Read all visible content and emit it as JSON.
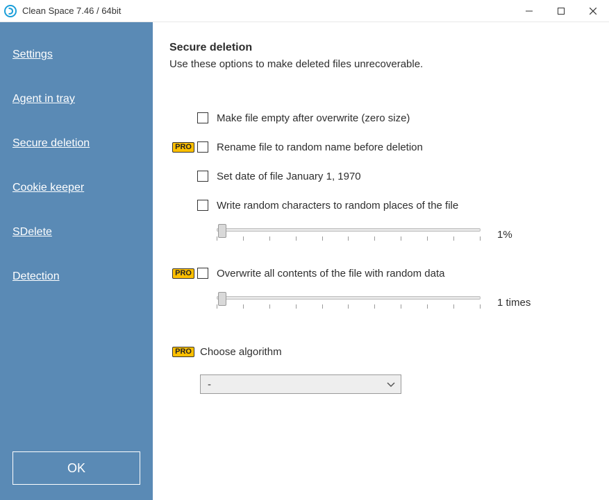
{
  "window": {
    "title": "Clean Space 7.46 / 64bit"
  },
  "sidebar": {
    "items": [
      {
        "label": "Settings"
      },
      {
        "label": "Agent in tray"
      },
      {
        "label": "Secure deletion"
      },
      {
        "label": "Cookie keeper"
      },
      {
        "label": "SDelete"
      },
      {
        "label": "Detection"
      }
    ],
    "ok_label": "OK"
  },
  "main": {
    "heading": "Secure deletion",
    "subtitle": "Use these options to make deleted files unrecoverable.",
    "pro_badge": "PRO",
    "options": {
      "make_empty": "Make file empty after overwrite (zero size)",
      "rename_random": "Rename file to random name before deletion",
      "set_date": "Set date of file January 1, 1970",
      "write_random_chars": "Write random characters to random places of the file",
      "overwrite_all": "Overwrite all contents of the file with random data"
    },
    "sliders": {
      "random_chars_value": "1%",
      "overwrite_times_value": "1 times"
    },
    "algorithm": {
      "label": "Choose algorithm",
      "selected": "-"
    }
  }
}
